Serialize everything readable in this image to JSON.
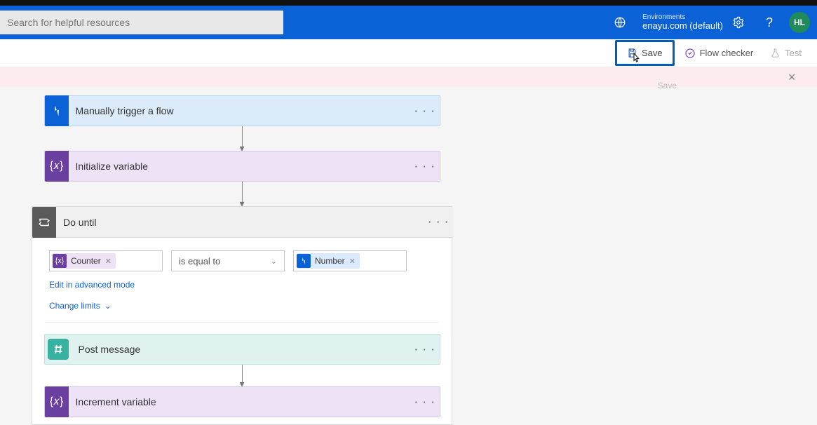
{
  "search": {
    "placeholder": "Search for helpful resources"
  },
  "environment": {
    "label": "Environments",
    "name": "enayu.com (default)"
  },
  "avatar": {
    "initials": "HL"
  },
  "toolbar": {
    "save": "Save",
    "flow_checker": "Flow checker",
    "test": "Test",
    "save_tooltip": "Save"
  },
  "steps": {
    "trigger": "Manually trigger a flow",
    "init_var": "Initialize variable",
    "do_until": "Do until",
    "post_msg": "Post message",
    "inc_var": "Increment variable"
  },
  "do_until": {
    "left_token": "Counter",
    "operator": "is equal to",
    "right_token": "Number",
    "edit_advanced": "Edit in advanced mode",
    "change_limits": "Change limits"
  }
}
